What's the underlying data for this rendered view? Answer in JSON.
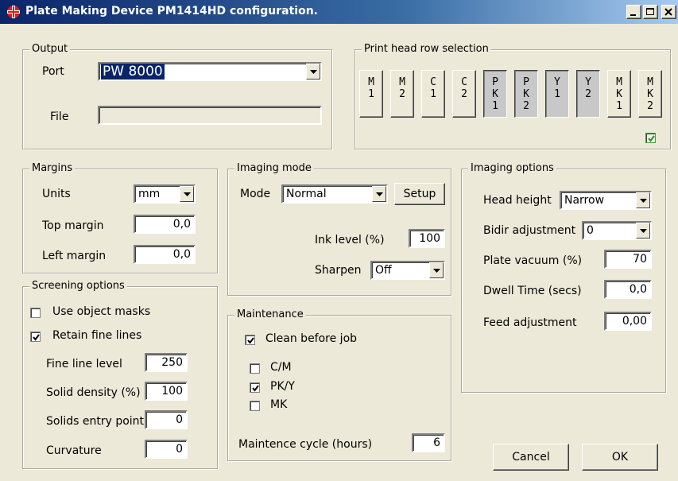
{
  "window": {
    "title": "Plate Making Device PM1414HD configuration."
  },
  "output": {
    "legend": "Output",
    "port_label": "Port",
    "port_value": "PW 8000",
    "file_label": "File",
    "file_value": ""
  },
  "print_head": {
    "legend": "Print head row selection",
    "heads": [
      {
        "label": "M\n1",
        "selected": false
      },
      {
        "label": "M\n2",
        "selected": false
      },
      {
        "label": "C\n1",
        "selected": false
      },
      {
        "label": "C\n2",
        "selected": false
      },
      {
        "label": "P\nK\n1",
        "selected": true
      },
      {
        "label": "P\nK\n2",
        "selected": true
      },
      {
        "label": "Y\n1",
        "selected": true
      },
      {
        "label": "Y\n2",
        "selected": true
      },
      {
        "label": "M\nK\n1",
        "selected": false
      },
      {
        "label": "M\nK\n2",
        "selected": false
      }
    ],
    "mk2_check": true
  },
  "margins": {
    "legend": "Margins",
    "units_label": "Units",
    "units_value": "mm",
    "top_label": "Top margin",
    "top_value": "0,0",
    "left_label": "Left margin",
    "left_value": "0,0"
  },
  "screening": {
    "legend": "Screening options",
    "use_masks_label": "Use object masks",
    "use_masks": false,
    "retain_fine_label": "Retain fine lines",
    "retain_fine": true,
    "fine_level_label": "Fine line level",
    "fine_level_value": "250",
    "solid_density_label": "Solid density (%)",
    "solid_density_value": "100",
    "solids_entry_label": "Solids entry point",
    "solids_entry_value": "0",
    "curvature_label": "Curvature",
    "curvature_value": "0"
  },
  "imaging_mode": {
    "legend": "Imaging mode",
    "mode_label": "Mode",
    "mode_value": "Normal",
    "setup_label": "Setup",
    "ink_label": "Ink level (%)",
    "ink_value": "100",
    "sharpen_label": "Sharpen",
    "sharpen_value": "Off"
  },
  "maintenance": {
    "legend": "Maintenance",
    "clean_label": "Clean before job",
    "clean": true,
    "cm_label": "C/M",
    "cm": false,
    "pky_label": "PK/Y",
    "pky": true,
    "mk_label": "MK",
    "mk": false,
    "cycle_label": "Maintence cycle (hours)",
    "cycle_value": "6"
  },
  "imaging_options": {
    "legend": "Imaging options",
    "head_height_label": "Head height",
    "head_height_value": "Narrow",
    "bidir_label": "Bidir adjustment",
    "bidir_value": "0",
    "vacuum_label": "Plate vacuum (%)",
    "vacuum_value": "70",
    "dwell_label": "Dwell Time (secs)",
    "dwell_value": "0,0",
    "feed_label": "Feed adjustment",
    "feed_value": "0,00"
  },
  "buttons": {
    "cancel": "Cancel",
    "ok": "OK"
  }
}
